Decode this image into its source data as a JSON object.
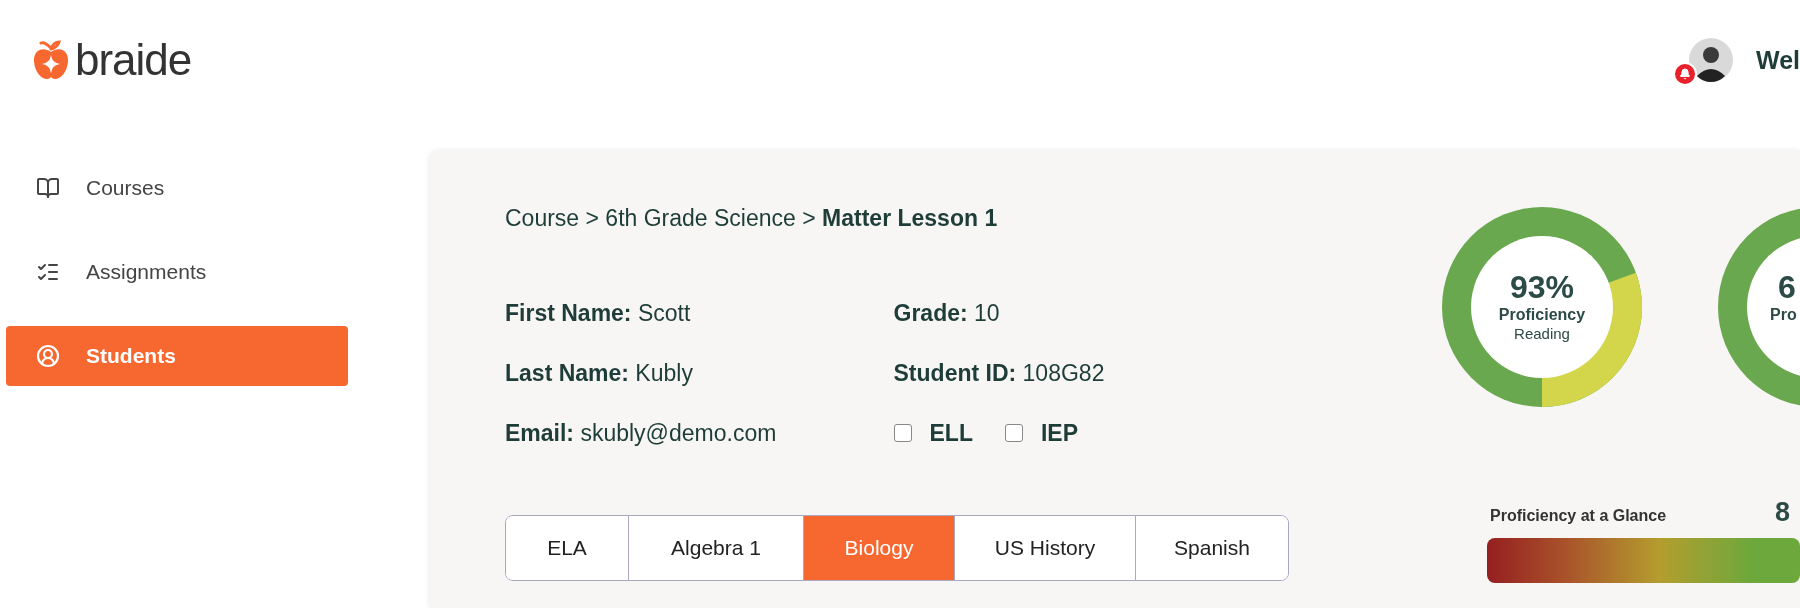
{
  "brand": {
    "name": "braide"
  },
  "header": {
    "greeting": "Wel"
  },
  "sidebar": {
    "items": [
      {
        "label": "Courses",
        "selected": false
      },
      {
        "label": "Assignments",
        "selected": false
      },
      {
        "label": "Students",
        "selected": true
      }
    ]
  },
  "breadcrumb": "Course > 6th Grade Science > **Matter Lesson 1**",
  "student": {
    "left_fields": [
      "**First Name:** Scott",
      "**Last Name:** Kubly",
      "**Email:** skubly@demo.com"
    ],
    "right_fields": [
      "**Grade:** 10",
      "**Student ID:** 108G82"
    ],
    "flags": [
      {
        "label": "ELL",
        "checked": false
      },
      {
        "label": "IEP",
        "checked": false
      }
    ]
  },
  "subjects": [
    {
      "label": "ELA",
      "selected": false
    },
    {
      "label": "Algebra 1",
      "selected": false
    },
    {
      "label": "Biology",
      "selected": true
    },
    {
      "label": "US History",
      "selected": false
    },
    {
      "label": "Spanish",
      "selected": false
    }
  ],
  "proficiency": {
    "donuts": [
      {
        "value": "93%",
        "title": "Proficiency",
        "subtitle": "Reading"
      },
      {
        "value": "6",
        "title": "Pro"
      }
    ],
    "glance": {
      "label": "Proficiency at a Glance",
      "value": "8"
    }
  }
}
